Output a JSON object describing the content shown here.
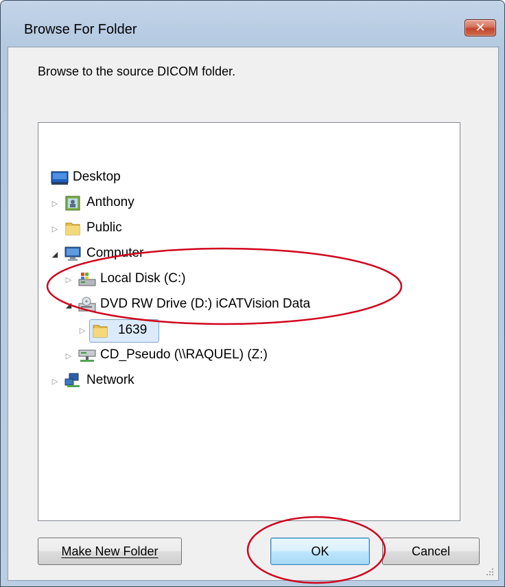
{
  "window": {
    "title": "Browse For Folder",
    "close_glyph": "✕"
  },
  "prompt": "Browse to the source DICOM folder.",
  "tree": {
    "items": [
      {
        "label": "Desktop",
        "icon": "desktop-icon",
        "expander": ""
      },
      {
        "label": "Anthony",
        "icon": "user-folder-icon",
        "expander": "▷"
      },
      {
        "label": "Public",
        "icon": "folder-icon",
        "expander": "▷"
      },
      {
        "label": "Computer",
        "icon": "computer-icon",
        "expander": "◢"
      },
      {
        "label": "Local Disk (C:)",
        "icon": "hard-drive-icon",
        "expander": "▷"
      },
      {
        "label": "DVD RW Drive (D:) iCATVision Data",
        "icon": "dvd-drive-icon",
        "expander": "◢"
      },
      {
        "label": "1639",
        "icon": "folder-icon",
        "expander": "▷",
        "selected": true
      },
      {
        "label": "CD_Pseudo (\\\\RAQUEL) (Z:)",
        "icon": "network-drive-icon",
        "expander": "▷"
      },
      {
        "label": "Network",
        "icon": "network-icon",
        "expander": "▷"
      }
    ]
  },
  "buttons": {
    "make_new_folder": "Make New Folder",
    "ok": "OK",
    "cancel": "Cancel"
  },
  "colors": {
    "annotation": "#d0021b",
    "selection": "#dcebfc"
  }
}
